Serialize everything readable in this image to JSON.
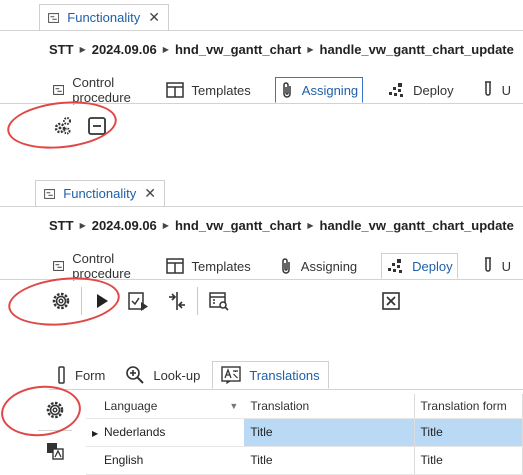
{
  "panel1": {
    "tab_title": "Functionality",
    "breadcrumb": [
      "STT",
      "2024.09.06",
      "hnd_vw_gantt_chart",
      "handle_vw_gantt_chart_update"
    ],
    "tabs": [
      "Control procedure",
      "Templates",
      "Assigning",
      "Deploy",
      "U"
    ],
    "selected_tab": "Assigning"
  },
  "panel2": {
    "tab_title": "Functionality",
    "breadcrumb": [
      "STT",
      "2024.09.06",
      "hnd_vw_gantt_chart",
      "handle_vw_gantt_chart_update"
    ],
    "tabs": [
      "Control procedure",
      "Templates",
      "Assigning",
      "Deploy",
      "U"
    ],
    "selected_tab": "Deploy"
  },
  "subtabs": [
    "Form",
    "Look-up",
    "Translations"
  ],
  "selected_subtab": "Translations",
  "grid": {
    "columns": [
      "Language",
      "Translation",
      "Translation form"
    ],
    "rows": [
      [
        "Nederlands",
        "Title",
        "Title"
      ],
      [
        "English",
        "Title",
        "Title"
      ]
    ]
  },
  "colors": {
    "accent": "#1f5fa8",
    "annotation": "#e04848",
    "selection": "#b9d9f5"
  }
}
